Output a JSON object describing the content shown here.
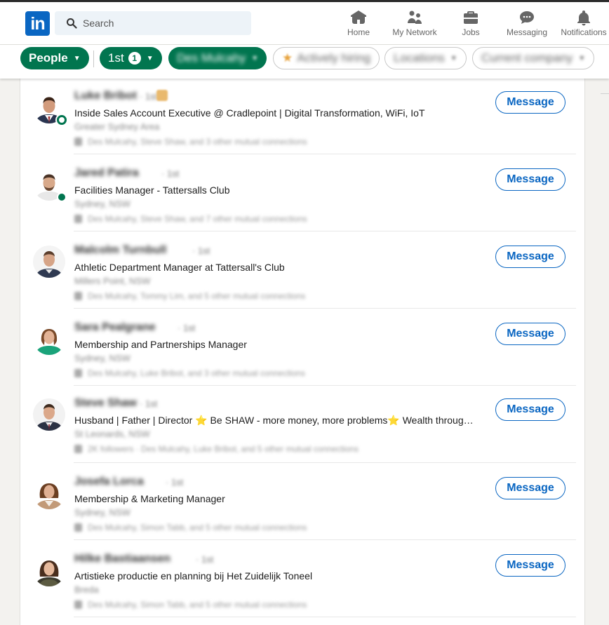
{
  "nav": {
    "search_placeholder": "Search",
    "items": [
      {
        "label": "Home",
        "icon": "home-icon"
      },
      {
        "label": "My Network",
        "icon": "network-icon"
      },
      {
        "label": "Jobs",
        "icon": "briefcase-icon"
      },
      {
        "label": "Messaging",
        "icon": "messaging-icon"
      },
      {
        "label": "Notifications",
        "icon": "bell-icon"
      }
    ]
  },
  "filters": {
    "people": "People",
    "first_degree": "1st",
    "first_degree_count": "1",
    "connection_of": "Des Mulcahy",
    "actively_hiring": "Actively hiring",
    "locations": "Locations",
    "current_company": "Current company"
  },
  "results": [
    {
      "name": "Luke Bribot",
      "degree": "· 1st",
      "headline": "Inside Sales Account Executive @ Cradlepoint | Digital Transformation, WiFi, IoT",
      "location": "Greater Sydney Area",
      "mutual": "Des Mulcahy, Steve Shaw, and 3 other mutual connections",
      "button": "Message",
      "status": "ring"
    },
    {
      "name": "Jared Patira",
      "degree": "· 1st",
      "headline": "Facilities Manager - Tattersalls Club",
      "location": "Sydney, NSW",
      "mutual": "Des Mulcahy, Steve Shaw, and 7 other mutual connections",
      "button": "Message",
      "status": "dot"
    },
    {
      "name": "Malcolm Turnbull",
      "degree": "· 1st",
      "headline": "Athletic Department Manager at Tattersall's Club",
      "location": "Millers Point, NSW",
      "mutual": "Des Mulcahy, Tommy Lim, and 5 other mutual connections",
      "button": "Message",
      "status": "none"
    },
    {
      "name": "Sara Pealgrane",
      "degree": "· 1st",
      "headline": "Membership and Partnerships Manager",
      "location": "Sydney, NSW",
      "mutual": "Des Mulcahy, Luke Bribot, and 3 other mutual connections",
      "button": "Message",
      "status": "none"
    },
    {
      "name": "Steve Shaw",
      "degree": "· 1st",
      "headline": "Husband | Father | Director ⭐ Be SHAW - more money, more problems⭐ Wealth through property and business",
      "location": "St Leonards, NSW",
      "mutual": "2K followers · Des Mulcahy, Luke Bribot, and 5 other mutual connections",
      "button": "Message",
      "status": "none"
    },
    {
      "name": "Josefa Lorca",
      "degree": "· 1st",
      "headline": "Membership & Marketing Manager",
      "location": "Sydney, NSW",
      "mutual": "Des Mulcahy, Simon Tabb, and 5 other mutual connections",
      "button": "Message",
      "status": "none"
    },
    {
      "name": "Hilke Bastiaansen",
      "degree": "· 1st",
      "headline": "Artistieke productie en planning bij Het Zuidelijk Toneel",
      "location": "Breda",
      "mutual": "Des Mulcahy, Simon Tabb, and 5 other mutual connections",
      "button": "Message",
      "status": "none"
    }
  ]
}
